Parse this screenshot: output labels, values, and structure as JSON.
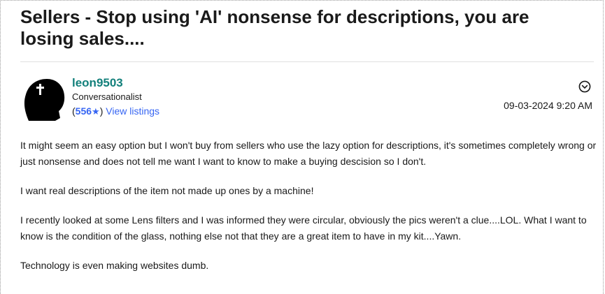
{
  "post": {
    "title": "Sellers - Stop using 'AI' nonsense for descriptions, you are losing sales....",
    "author": {
      "username": "leon9503",
      "rank": "Conversationalist",
      "feedback_open": "(",
      "feedback_score": "556",
      "feedback_close": ")",
      "view_listings": "View listings",
      "star_icon": "star-icon"
    },
    "timestamp": "09-03-2024 9:20 AM",
    "paragraphs": [
      "It might seem an easy option but I won't buy from sellers who use the lazy option for descriptions, it's sometimes completely wrong or just nonsense and does not tell me want I want to know to make a buying descision so I don't.",
      "I want real descriptions of the item not made up ones by a machine!",
      "I recently looked at some Lens filters and I was informed they were circular, obviously the pics weren't a clue....LOL. What I want to know is the condition of the glass, nothing else not that they are a great item to have in my kit....Yawn.",
      "Technology is even making websites dumb."
    ]
  },
  "colors": {
    "username": "#13807b",
    "link": "#3665f3",
    "text": "#191919"
  }
}
